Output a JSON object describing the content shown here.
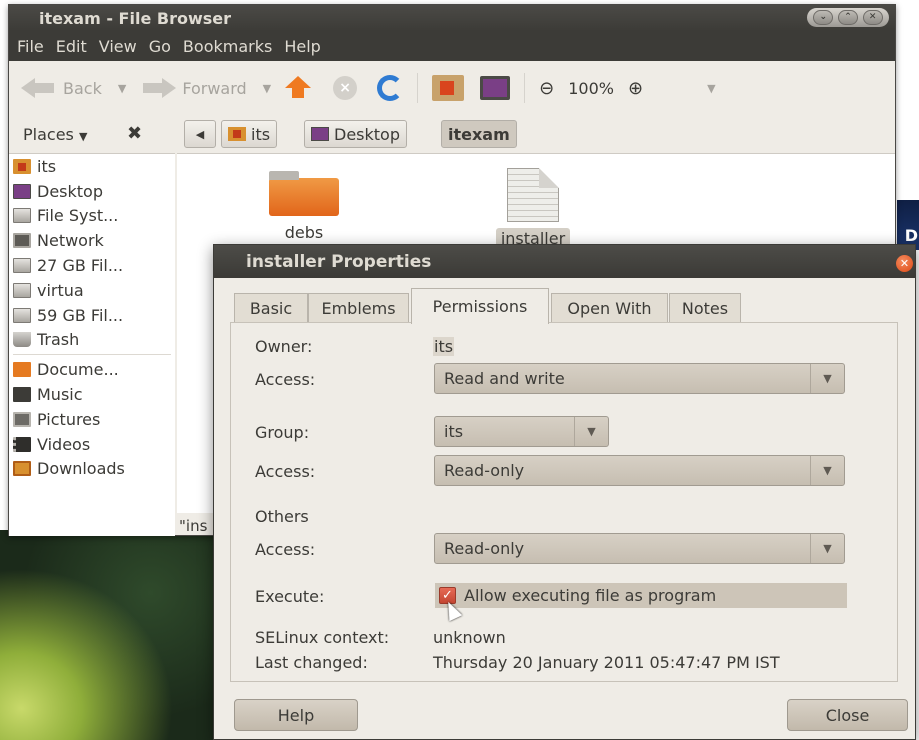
{
  "file_browser": {
    "title": "itexam - File Browser",
    "menu": [
      "File",
      "Edit",
      "View",
      "Go",
      "Bookmarks",
      "Help"
    ],
    "toolbar": {
      "back_label": "Back",
      "forward_label": "Forward",
      "zoom_level": "100%"
    },
    "places_label": "Places",
    "breadcrumbs": [
      "its",
      "Desktop",
      "itexam"
    ],
    "sidebar": [
      {
        "label": "its",
        "icon": "home-folder-icon"
      },
      {
        "label": "Desktop",
        "icon": "desktop-icon"
      },
      {
        "label": "File Syst...",
        "icon": "drive-icon"
      },
      {
        "label": "Network",
        "icon": "network-icon"
      },
      {
        "label": "27 GB Fil...",
        "icon": "drive-icon"
      },
      {
        "label": "virtua",
        "icon": "drive-icon"
      },
      {
        "label": "59 GB Fil...",
        "icon": "drive-icon"
      },
      {
        "label": "Trash",
        "icon": "trash-icon"
      },
      {
        "label": "Docume...",
        "icon": "folder-icon"
      },
      {
        "label": "Music",
        "icon": "music-icon"
      },
      {
        "label": "Pictures",
        "icon": "pictures-icon"
      },
      {
        "label": "Videos",
        "icon": "videos-icon"
      },
      {
        "label": "Downloads",
        "icon": "downloads-icon"
      }
    ],
    "files": [
      {
        "name": "debs",
        "type": "folder"
      },
      {
        "name": "installer",
        "type": "file",
        "selected": true
      }
    ],
    "status_text": "\"ins"
  },
  "dialog": {
    "title": "installer Properties",
    "tabs": [
      "Basic",
      "Emblems",
      "Permissions",
      "Open With",
      "Notes"
    ],
    "active_tab": "Permissions",
    "owner_label": "Owner:",
    "owner_value": "its",
    "owner_access_label": "Access:",
    "owner_access_value": "Read and write",
    "group_label": "Group:",
    "group_value": "its",
    "group_access_label": "Access:",
    "group_access_value": "Read-only",
    "others_label": "Others",
    "others_access_label": "Access:",
    "others_access_value": "Read-only",
    "execute_label": "Execute:",
    "execute_checkbox_label": "Allow executing file as program",
    "execute_checked": true,
    "selinux_label": "SELinux context:",
    "selinux_value": "unknown",
    "last_changed_label": "Last changed:",
    "last_changed_value": "Thursday 20 January 2011 05:47:47 PM IST",
    "help_button": "Help",
    "close_button": "Close"
  },
  "colors": {
    "titlebar": "#3c3b37",
    "window_bg": "#efece6",
    "accent": "#dd4814"
  }
}
